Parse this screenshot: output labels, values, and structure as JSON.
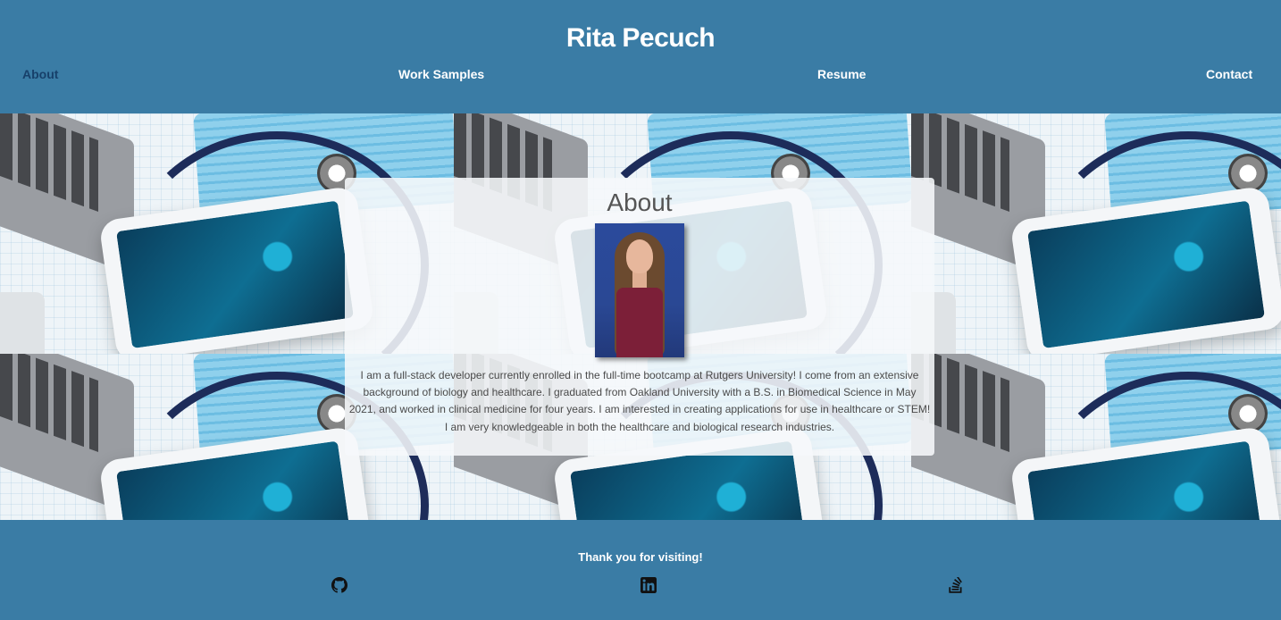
{
  "header": {
    "title": "Rita Pecuch",
    "nav": [
      {
        "label": "About",
        "active": true
      },
      {
        "label": "Work Samples",
        "active": false
      },
      {
        "label": "Resume",
        "active": false
      },
      {
        "label": "Contact",
        "active": false
      }
    ]
  },
  "about": {
    "heading": "About",
    "body": "I am a full-stack developer currently enrolled in the full-time bootcamp at Rutgers University! I come from an extensive background of biology and healthcare. I graduated from Oakland University with a B.S. in Biomedical Science in May 2021, and worked in clinical medicine for four years. I am interested in creating applications for use in healthcare or STEM! I am very knowledgeable in both the healthcare and biological research industries."
  },
  "footer": {
    "thanks": "Thank you for visiting!",
    "icons": [
      "github-icon",
      "linkedin-icon",
      "stack-overflow-icon"
    ]
  },
  "colors": {
    "primary": "#3a7ca5",
    "nav_active": "#17406a",
    "text_white": "#ffffff"
  }
}
